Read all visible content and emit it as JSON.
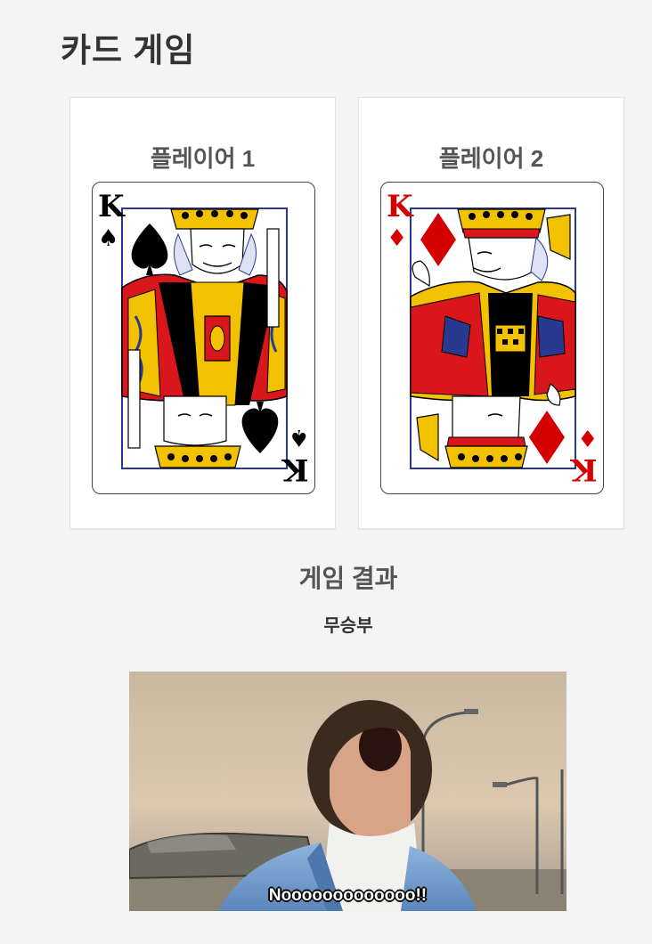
{
  "page": {
    "title": "카드 게임"
  },
  "players": [
    {
      "name": "플레이어 1",
      "card": {
        "rank": "K",
        "suit": "♠",
        "suit_name": "spades",
        "color": "#000000"
      }
    },
    {
      "name": "플레이어 2",
      "card": {
        "rank": "K",
        "suit": "♦",
        "suit_name": "diamonds",
        "color": "#d40000"
      }
    }
  ],
  "result": {
    "title": "게임 결과",
    "text": "무승부"
  },
  "reaction": {
    "caption": "Nooooooooooooo!!"
  },
  "colors": {
    "background": "#f4f4f4",
    "card_gold": "#f2c200",
    "card_red": "#d9161b",
    "card_blue": "#2a3990"
  }
}
